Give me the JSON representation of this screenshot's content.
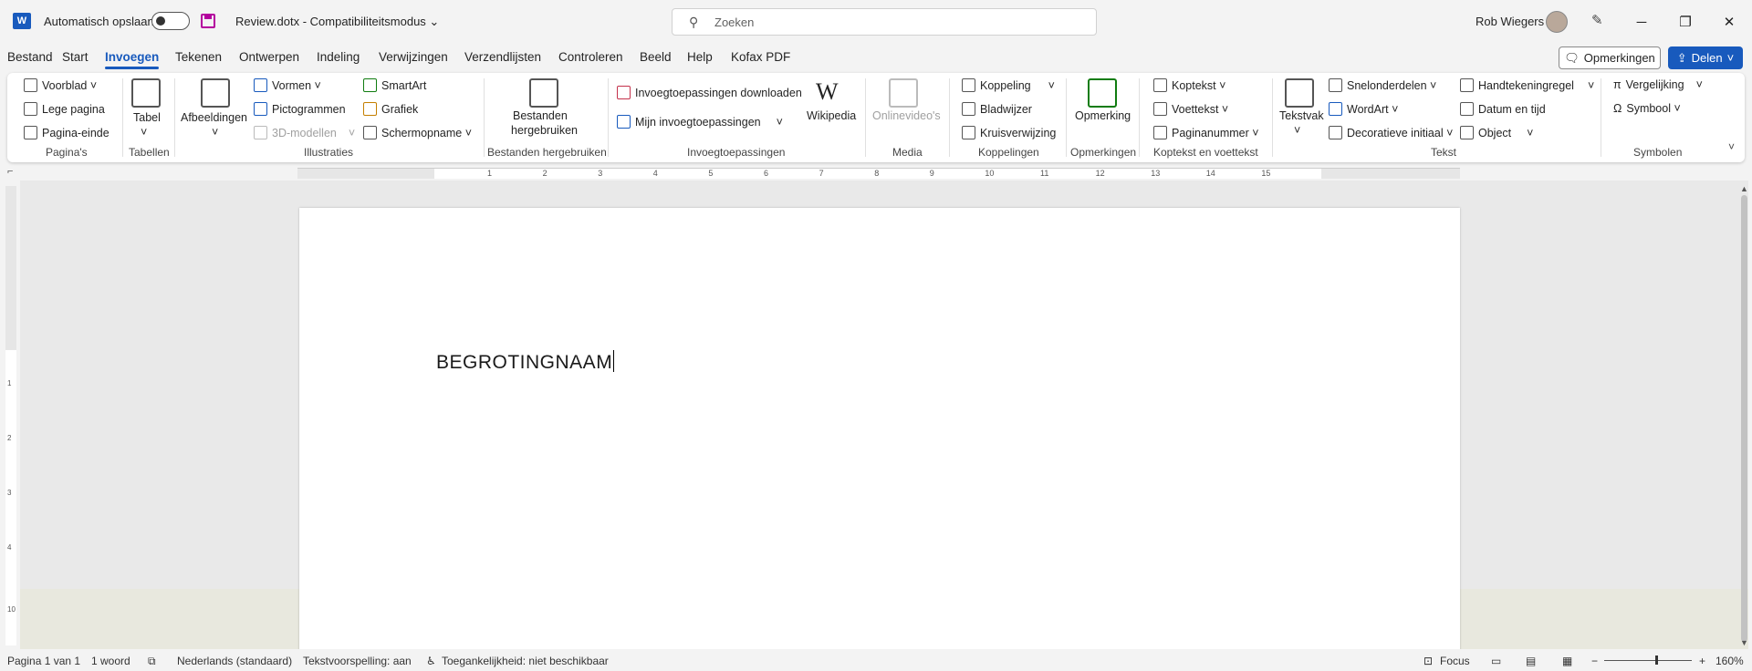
{
  "titlebar": {
    "autosave_label": "Automatisch opslaan",
    "doc_title": "Review.dotx  -  Compatibiliteitsmodus ⌄",
    "search_placeholder": "Zoeken",
    "user_name": "Rob Wiegers",
    "minimize": "─",
    "restore": "❐",
    "close": "✕"
  },
  "menu": {
    "items": [
      "Bestand",
      "Start",
      "Invoegen",
      "Tekenen",
      "Ontwerpen",
      "Indeling",
      "Verwijzingen",
      "Verzendlijsten",
      "Controleren",
      "Beeld",
      "Help",
      "Kofax PDF"
    ],
    "comments_label": "Opmerkingen",
    "share_label": "Delen"
  },
  "ribbon": {
    "paginas": {
      "voorblad": "Voorblad ˅",
      "lege_pagina": "Lege pagina",
      "pagina_einde": "Pagina-einde",
      "group": "Pagina's"
    },
    "tabellen": {
      "tabel": "Tabel",
      "group": "Tabellen"
    },
    "illustraties": {
      "afbeeldingen": "Afbeeldingen",
      "vormen": "Vormen ˅",
      "pictogrammen": "Pictogrammen",
      "modellen3d": "3D-modellen",
      "smartart": "SmartArt",
      "grafiek": "Grafiek",
      "schermopname": "Schermopname ˅",
      "group": "Illustraties"
    },
    "hergebruiken": {
      "line1": "Bestanden",
      "line2": "hergebruiken",
      "group": "Bestanden hergebruiken"
    },
    "invoegtoepassingen": {
      "downloaden": "Invoegtoepassingen downloaden",
      "mijn": "Mijn invoegtoepassingen",
      "wikipedia": "Wikipedia",
      "group": "Invoegtoepassingen"
    },
    "media": {
      "onlinevideos": "Onlinevideo's",
      "group": "Media"
    },
    "koppelingen": {
      "koppeling": "Koppeling",
      "bladwijzer": "Bladwijzer",
      "kruisverwijzing": "Kruisverwijzing",
      "group": "Koppelingen"
    },
    "opmerkingen": {
      "opmerking": "Opmerking",
      "group": "Opmerkingen"
    },
    "koptekst": {
      "koptekst": "Koptekst ˅",
      "voettekst": "Voettekst ˅",
      "paginanummer": "Paginanummer ˅",
      "group": "Koptekst en voettekst"
    },
    "tekst": {
      "tekstvak": "Tekstvak",
      "snelonderdelen": "Snelonderdelen ˅",
      "wordart": "WordArt ˅",
      "decoratieve_initiaal": "Decoratieve initiaal ˅",
      "handtekeningregel": "Handtekeningregel",
      "datum_tijd": "Datum en tijd",
      "object": "Object",
      "group": "Tekst"
    },
    "symbolen": {
      "vergelijking": "Vergelijking",
      "symbool": "Symbool ˅",
      "group": "Symbolen"
    }
  },
  "ruler_ticks": [
    "1",
    "2",
    "3",
    "4",
    "5",
    "6",
    "7",
    "8",
    "9",
    "10",
    "11",
    "12",
    "13",
    "14",
    "15"
  ],
  "vruler_ticks": [
    "1",
    "2",
    "3",
    "4",
    "10"
  ],
  "document": {
    "text": "BEGROTINGNAAM"
  },
  "statusbar": {
    "page": "Pagina 1 van 1",
    "words": "1 woord",
    "language": "Nederlands (standaard)",
    "prediction": "Tekstvoorspelling: aan",
    "accessibility": "Toegankelijkheid: niet beschikbaar",
    "focus": "Focus",
    "zoom": "160%"
  }
}
